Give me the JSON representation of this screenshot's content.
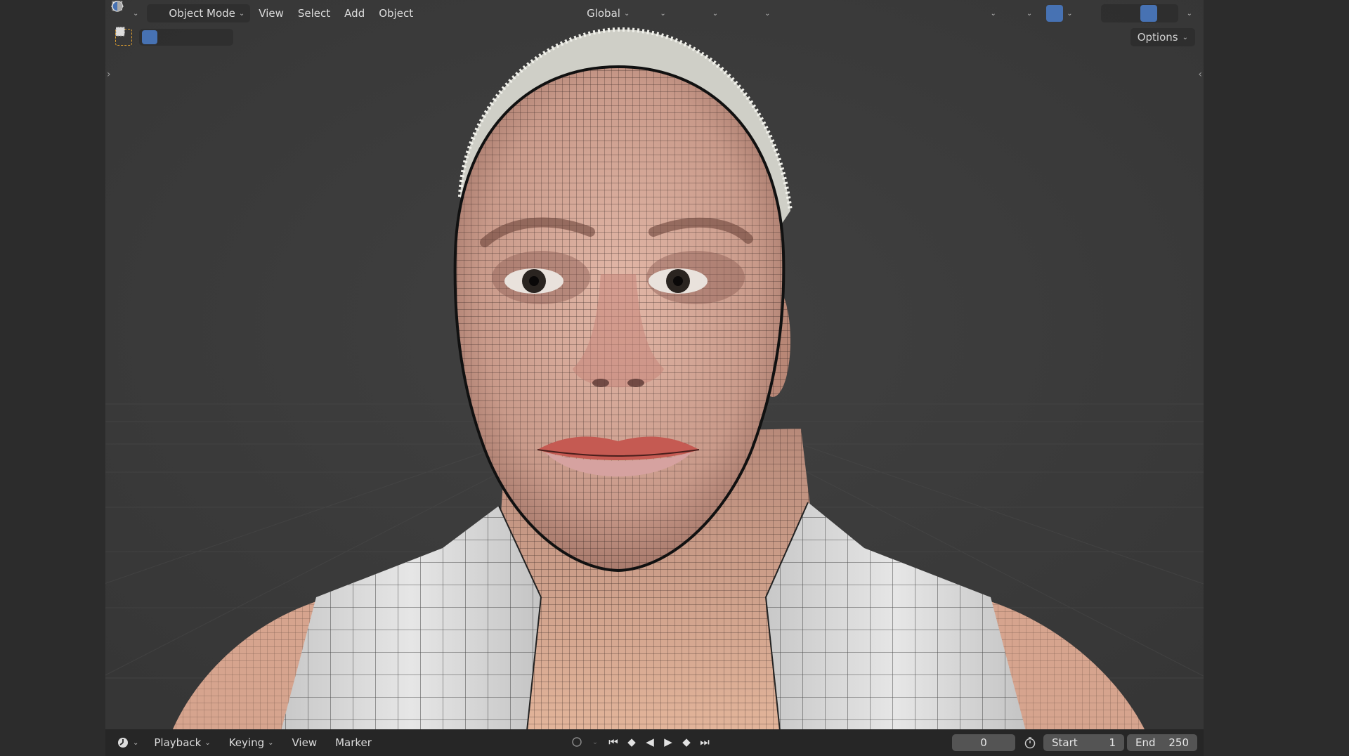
{
  "header": {
    "mode_label": "Object Mode",
    "menus": [
      "View",
      "Select",
      "Add",
      "Object"
    ],
    "orientation_label": "Global",
    "options_label": "Options"
  },
  "timeline": {
    "menus": [
      "Playback",
      "Keying",
      "View",
      "Marker"
    ],
    "current_frame": "0",
    "start_label": "Start",
    "start_value": "1",
    "end_label": "End",
    "end_value": "250"
  },
  "colors": {
    "accent": "#4772b3",
    "viewport_bg": "#3b3b3b",
    "header_bg": "#262626",
    "select_tool": "#e0a030"
  },
  "icons": {
    "editor_type": "editor-type-icon",
    "mode": "object-mode-icon",
    "transform": "transform-orientation-icon",
    "pivot": "pivot-icon",
    "snap": "snap-magnet-icon",
    "proportional": "proportional-edit-icon",
    "visibility": "eye-icon",
    "gizmo": "gizmo-icon",
    "overlays": "overlays-icon",
    "xray": "xray-icon",
    "shading": [
      "wireframe-shading-icon",
      "solid-shading-icon",
      "material-shading-icon",
      "rendered-shading-icon"
    ],
    "clock": "clock-icon"
  }
}
